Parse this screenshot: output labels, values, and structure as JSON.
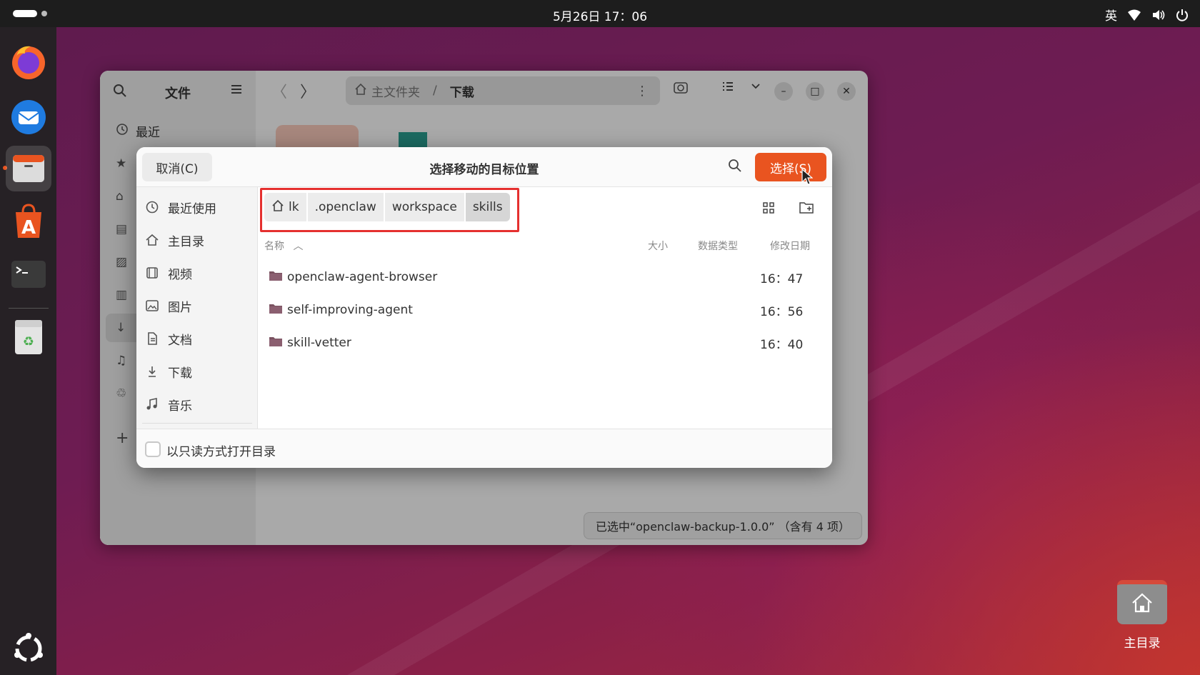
{
  "topbar": {
    "clock": "5月26日 17：06",
    "input_method": "英"
  },
  "dock": {
    "items": [
      "firefox",
      "thunderbird",
      "files",
      "app-center",
      "terminal",
      "trash"
    ],
    "show_apps": "ubuntu-logo"
  },
  "file_manager": {
    "sidebar_title": "文件",
    "sidebar_recent": "最近",
    "path_home": "主文件夹",
    "path_sep": "/",
    "path_current": "下载",
    "status": "已选中“openclaw-backup-1.0.0” （含有 4 项）"
  },
  "dialog": {
    "cancel_label": "取消(C)",
    "title": "选择移动的目标位置",
    "select_label": "选择(S)",
    "places": [
      {
        "label": "最近使用",
        "icon": "clock-icon"
      },
      {
        "label": "主目录",
        "icon": "home-icon"
      },
      {
        "label": "视频",
        "icon": "video-icon"
      },
      {
        "label": "图片",
        "icon": "image-icon"
      },
      {
        "label": "文档",
        "icon": "document-icon"
      },
      {
        "label": "下载",
        "icon": "download-icon"
      },
      {
        "label": "音乐",
        "icon": "music-icon"
      }
    ],
    "breadcrumbs": [
      "lk",
      ".openclaw",
      "workspace",
      "skills"
    ],
    "columns": {
      "name": "名称",
      "size": "大小",
      "type": "数据类型",
      "modified": "修改日期"
    },
    "rows": [
      {
        "name": "openclaw-agent-browser",
        "modified": "16：47"
      },
      {
        "name": "self-improving-agent",
        "modified": "16：56"
      },
      {
        "name": "skill-vetter",
        "modified": "16：40"
      }
    ],
    "readonly_label": "以只读方式打开目录"
  },
  "desktop": {
    "home_label": "主目录"
  },
  "colors": {
    "accent": "#e95420",
    "highlight": "#e5302f"
  }
}
